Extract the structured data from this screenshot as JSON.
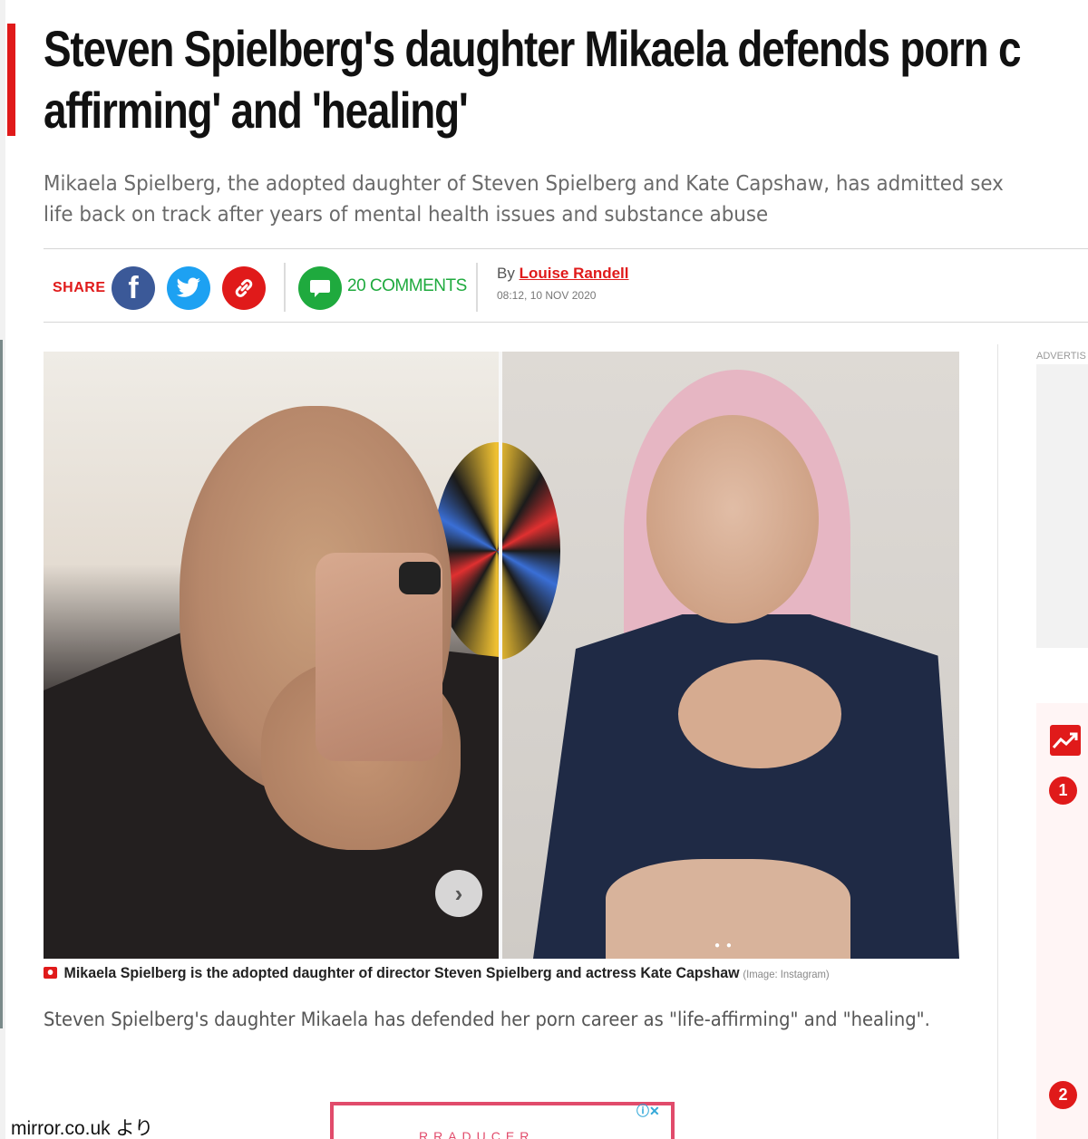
{
  "article": {
    "headline_line1": "Steven Spielberg's daughter Mikaela defends porn c",
    "headline_line2": "affirming' and 'healing'",
    "standfirst_line1": "Mikaela Spielberg, the adopted daughter of Steven Spielberg and Kate Capshaw, has admitted sex",
    "standfirst_line2": "life back on track after years of mental health issues and substance abuse",
    "body_first_paragraph": "Steven Spielberg's daughter Mikaela has defended her porn career as \"life-affirming\" and \"healing\"."
  },
  "share_bar": {
    "share_label": "SHARE",
    "facebook_icon": "facebook-icon",
    "twitter_icon": "twitter-icon",
    "link_icon": "link-icon",
    "comment_icon": "comment-bubble-icon",
    "comments_label": "20 COMMENTS",
    "by_prefix": "By",
    "author": "Louise Randell",
    "timestamp": "08:12, 10 NOV 2020"
  },
  "gallery": {
    "caption": "Mikaela Spielberg is the adopted daughter of director Steven Spielberg and actress Kate Capshaw",
    "credit": "(Image: Instagram)",
    "next_glyph": "›",
    "dots": "● ●"
  },
  "sidebar": {
    "advert_label": "ADVERTIS",
    "trending_icon": "trending-chart-icon",
    "ranks": [
      "1",
      "2"
    ]
  },
  "ad": {
    "close_glyph": "ⓘ✕",
    "brand_fragment": "RRADUCER"
  },
  "overlay": {
    "source_note": "mirror.co.uk より"
  },
  "colors": {
    "accent_red": "#e01a1a",
    "facebook_blue": "#3b5998",
    "twitter_blue": "#1da1f2",
    "comment_green": "#1faa3e"
  }
}
